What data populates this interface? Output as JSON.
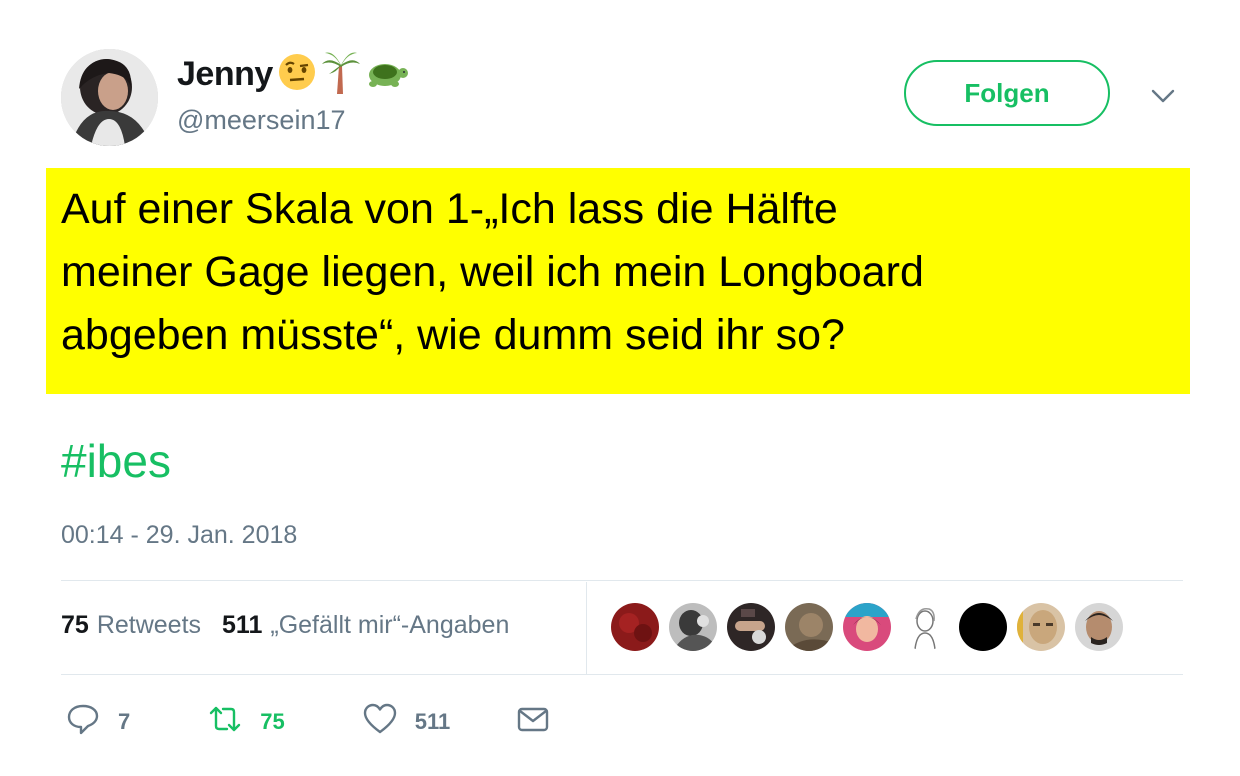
{
  "user": {
    "display_name": "Jenny",
    "name_emojis": [
      "face-with-raised-eyebrow",
      "palm-tree",
      "turtle"
    ],
    "handle": "@meersein17"
  },
  "follow_button": {
    "label": "Folgen"
  },
  "tweet": {
    "text": "Auf einer Skala von 1-„Ich lass die Hälfte\nmeiner Gage liegen, weil ich mein Longboard\nabgeben müsste“, wie dumm seid ihr so?",
    "hashtag": "#ibes",
    "highlight_color": "#ffff00",
    "timestamp": "00:14 - 29. Jan. 2018"
  },
  "stats": {
    "retweets_count": "75",
    "retweets_label": "Retweets",
    "likes_count": "511",
    "likes_label": "„Gefällt mir“-Angaben"
  },
  "likers": [
    {
      "icon": "avatar-red",
      "color": "#8b1a1a"
    },
    {
      "icon": "avatar-bw-photo",
      "color": "#6d6d6d"
    },
    {
      "icon": "avatar-dark-hand",
      "color": "#3b3433"
    },
    {
      "icon": "avatar-brown",
      "color": "#7a6a55"
    },
    {
      "icon": "avatar-pink-pattern",
      "color": "#c8336b"
    },
    {
      "icon": "avatar-sketch",
      "color": "#e8e8e8"
    },
    {
      "icon": "avatar-black",
      "color": "#000000"
    },
    {
      "icon": "avatar-face",
      "color": "#c9a77c"
    },
    {
      "icon": "avatar-man",
      "color": "#4a4440"
    }
  ],
  "actions": {
    "reply_count": "7",
    "retweet_count": "75",
    "like_count": "511"
  },
  "colors": {
    "accent": "#17bf63",
    "secondary_text": "#657786",
    "primary_text": "#14171a",
    "divider": "#e1e8ed"
  }
}
